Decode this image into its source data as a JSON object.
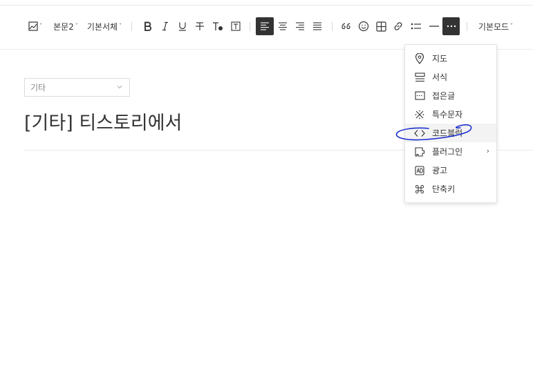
{
  "toolbar": {
    "paragraph_style": "본문2",
    "font_family": "기본서체",
    "mode": "기본모드"
  },
  "editor": {
    "category_value": "기타",
    "title": "[기타] 티스토리에서"
  },
  "more_menu": {
    "items": [
      {
        "label": "지도",
        "icon": "map-pin-icon"
      },
      {
        "label": "서식",
        "icon": "template-icon"
      },
      {
        "label": "접은글",
        "icon": "fold-icon"
      },
      {
        "label": "특수문자",
        "icon": "special-char-icon"
      },
      {
        "label": "코드블럭",
        "icon": "code-icon"
      },
      {
        "label": "플러그인",
        "icon": "plugin-icon"
      },
      {
        "label": "광고",
        "icon": "ad-icon"
      },
      {
        "label": "단축키",
        "icon": "command-icon"
      }
    ]
  },
  "colors": {
    "active_button": "#333333",
    "annotation_ink": "#1a2fd0"
  }
}
